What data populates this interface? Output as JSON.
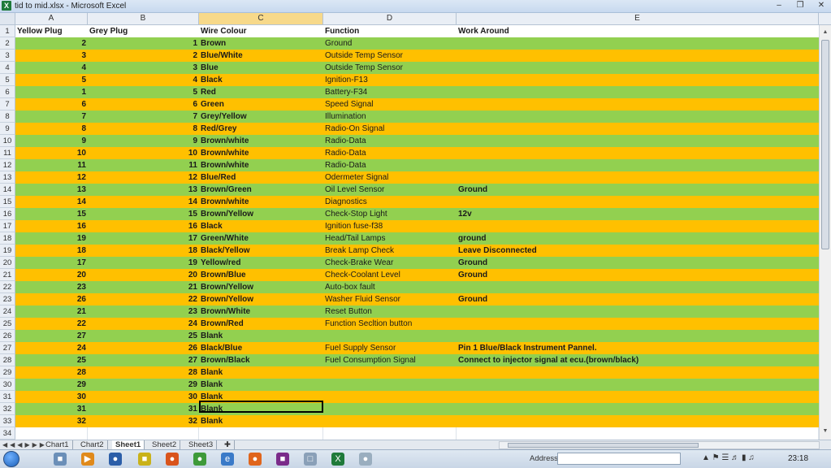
{
  "window": {
    "title": "tid to mid.xlsx - Microsoft Excel",
    "app_icon": "X"
  },
  "columns": [
    "A",
    "B",
    "C",
    "D",
    "E"
  ],
  "headers": [
    "Yellow Plug",
    "Grey Plug",
    "Wire Colour",
    "Function",
    "Work Around"
  ],
  "colors": {
    "green": "#92d050",
    "orange": "#ffc000",
    "header_bg": "#ffffff"
  },
  "rows": [
    {
      "n": "2",
      "a": "2",
      "b": "1",
      "c": "Brown",
      "d": "Ground",
      "e": "",
      "color": "green"
    },
    {
      "n": "3",
      "a": "3",
      "b": "2",
      "c": "Blue/White",
      "d": "Outside Temp Sensor",
      "e": "",
      "color": "orange"
    },
    {
      "n": "4",
      "a": "4",
      "b": "3",
      "c": "Blue",
      "d": "Outside Temp Sensor",
      "e": "",
      "color": "green"
    },
    {
      "n": "5",
      "a": "5",
      "b": "4",
      "c": "Black",
      "d": "Ignition-F13",
      "e": "",
      "color": "orange"
    },
    {
      "n": "6",
      "a": "1",
      "b": "5",
      "c": "Red",
      "d": "Battery-F34",
      "e": "",
      "color": "green"
    },
    {
      "n": "7",
      "a": "6",
      "b": "6",
      "c": "Green",
      "d": "Speed Signal",
      "e": "",
      "color": "orange"
    },
    {
      "n": "8",
      "a": "7",
      "b": "7",
      "c": "Grey/Yellow",
      "d": "Illumination",
      "e": "",
      "color": "green"
    },
    {
      "n": "9",
      "a": "8",
      "b": "8",
      "c": "Red/Grey",
      "d": "Radio-On Signal",
      "e": "",
      "color": "orange"
    },
    {
      "n": "10",
      "a": "9",
      "b": "9",
      "c": "Brown/white",
      "d": "Radio-Data",
      "e": "",
      "color": "green"
    },
    {
      "n": "11",
      "a": "10",
      "b": "10",
      "c": "Brown/white",
      "d": "Radio-Data",
      "e": "",
      "color": "orange"
    },
    {
      "n": "12",
      "a": "11",
      "b": "11",
      "c": "Brown/white",
      "d": "Radio-Data",
      "e": "",
      "color": "green"
    },
    {
      "n": "13",
      "a": "12",
      "b": "12",
      "c": "Blue/Red",
      "d": "Odermeter Signal",
      "e": "",
      "color": "orange"
    },
    {
      "n": "14",
      "a": "13",
      "b": "13",
      "c": "Brown/Green",
      "d": "Oil Level Sensor",
      "e": "Ground",
      "color": "green"
    },
    {
      "n": "15",
      "a": "14",
      "b": "14",
      "c": "Brown/white",
      "d": "Diagnostics",
      "e": "",
      "color": "orange"
    },
    {
      "n": "16",
      "a": "15",
      "b": "15",
      "c": "Brown/Yellow",
      "d": "Check-Stop Light",
      "e": "12v",
      "color": "green"
    },
    {
      "n": "17",
      "a": "16",
      "b": "16",
      "c": "Black",
      "d": "Ignition fuse-f38",
      "e": "",
      "color": "orange"
    },
    {
      "n": "18",
      "a": "19",
      "b": "17",
      "c": "Green/White",
      "d": "Head/Tail Lamps",
      "e": "ground",
      "color": "green"
    },
    {
      "n": "19",
      "a": "18",
      "b": "18",
      "c": "Black/Yellow",
      "d": "Break Lamp Check",
      "e": "Leave Disconnected",
      "color": "orange"
    },
    {
      "n": "20",
      "a": "17",
      "b": "19",
      "c": "Yellow/red",
      "d": "Check-Brake Wear",
      "e": "Ground",
      "color": "green"
    },
    {
      "n": "21",
      "a": "20",
      "b": "20",
      "c": "Brown/Blue",
      "d": "Check-Coolant Level",
      "e": "Ground",
      "color": "orange"
    },
    {
      "n": "22",
      "a": "23",
      "b": "21",
      "c": "Brown/Yellow",
      "d": "Auto-box fault",
      "e": "",
      "color": "green"
    },
    {
      "n": "23",
      "a": "26",
      "b": "22",
      "c": "Brown/Yellow",
      "d": "Washer Fluid Sensor",
      "e": "Ground",
      "color": "orange"
    },
    {
      "n": "24",
      "a": "21",
      "b": "23",
      "c": "Brown/White",
      "d": "Reset Button",
      "e": "",
      "color": "green"
    },
    {
      "n": "25",
      "a": "22",
      "b": "24",
      "c": "Brown/Red",
      "d": "Function Secltion button",
      "e": "",
      "color": "orange"
    },
    {
      "n": "26",
      "a": "27",
      "b": "25",
      "c": "Blank",
      "d": "",
      "e": "",
      "color": "green"
    },
    {
      "n": "27",
      "a": "24",
      "b": "26",
      "c": "Black/Blue",
      "d": "Fuel Supply Sensor",
      "e": "Pin 1 Blue/Black Instrument Pannel.",
      "color": "orange"
    },
    {
      "n": "28",
      "a": "25",
      "b": "27",
      "c": "Brown/Black",
      "d": "Fuel Consumption Signal",
      "e": "Connect to injector signal at ecu.(brown/black)",
      "color": "green"
    },
    {
      "n": "29",
      "a": "28",
      "b": "28",
      "c": "Blank",
      "d": "",
      "e": "",
      "color": "orange"
    },
    {
      "n": "30",
      "a": "29",
      "b": "29",
      "c": "Blank",
      "d": "",
      "e": "",
      "color": "green"
    },
    {
      "n": "31",
      "a": "30",
      "b": "30",
      "c": "Blank",
      "d": "",
      "e": "",
      "color": "orange"
    },
    {
      "n": "32",
      "a": "31",
      "b": "31",
      "c": "Blank",
      "d": "",
      "e": "",
      "color": "green"
    },
    {
      "n": "33",
      "a": "32",
      "b": "32",
      "c": "Blank",
      "d": "",
      "e": "",
      "color": "orange"
    }
  ],
  "header_row_num": "1",
  "last_row_num": "34",
  "sheet_tabs": [
    {
      "label": "Chart1",
      "active": false
    },
    {
      "label": "Chart2",
      "active": false
    },
    {
      "label": "Sheet1",
      "active": true
    },
    {
      "label": "Sheet2",
      "active": false
    },
    {
      "label": "Sheet3",
      "active": false
    }
  ],
  "taskbar": {
    "address_label": "Address",
    "clock": "23:18"
  }
}
